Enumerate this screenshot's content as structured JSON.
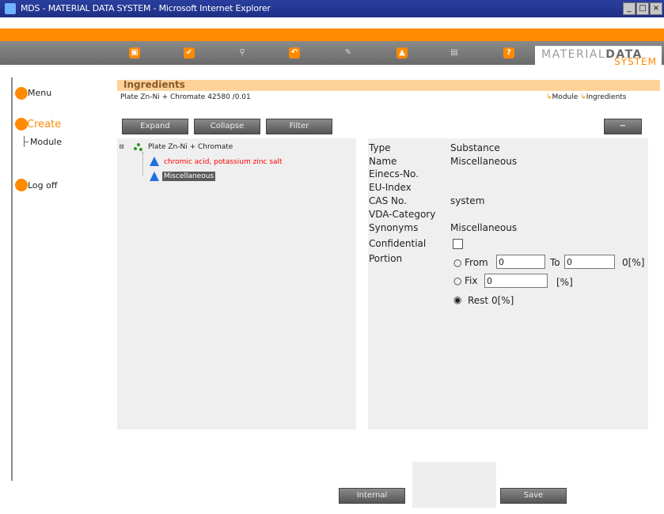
{
  "window": {
    "title": "MDS - MATERIAL DATA SYSTEM - Microsoft Internet Explorer",
    "controls": [
      "_",
      "□",
      "×"
    ]
  },
  "toolbar": {
    "icons": [
      "save-icon",
      "check-icon",
      "search-icon",
      "export-icon",
      "edit-icon",
      "warning-icon",
      "print-icon",
      "help-icon"
    ],
    "glyphs": [
      "▣",
      "✔",
      "⚲",
      "↶",
      "✎",
      "▲",
      "▤",
      "?"
    ]
  },
  "logo": {
    "line1a": "MATERIAL",
    "line1b": "DATA",
    "line2": "SYSTEM"
  },
  "nav": {
    "menu": "Menu",
    "create": "Create",
    "module": "Module",
    "logoff": "Log off"
  },
  "header": {
    "title": "Ingredients",
    "subtitle": "Plate Zn-Ni + Chromate 42580 /0.01",
    "crumb_module": "Module",
    "crumb_ingredients": "Ingredients"
  },
  "buttons": {
    "expand": "Expand",
    "collapse": "Collapse",
    "filter": "Filter",
    "minus": "−",
    "internal": "Internal",
    "save": "Save"
  },
  "tree": {
    "root": "Plate Zn-Ni + Chromate",
    "child1": "chromic acid, potassium zinc salt",
    "child2": "Miscellaneous"
  },
  "details": {
    "labels": {
      "type": "Type",
      "name": "Name",
      "einecs": "Einecs-No.",
      "euindex": "EU-Index",
      "cas": "CAS No.",
      "vda": "VDA-Category",
      "synonyms": "Synonyms",
      "confidential": "Confidential",
      "portion": "Portion"
    },
    "values": {
      "type": "Substance",
      "name": "Miscellaneous",
      "einecs": "",
      "euindex": "",
      "cas": "system",
      "vda": "",
      "synonyms": "Miscellaneous"
    },
    "portion": {
      "from_label": "From",
      "from_value": "0",
      "to_label": "To",
      "to_value": "0",
      "range_suffix": "0[%]",
      "fix_label": "Fix",
      "fix_value": "0",
      "fix_suffix": "[%]",
      "rest_label": "Rest 0[%]",
      "selected": "Rest 0[%]"
    },
    "confidential_checked": false
  },
  "colors": {
    "accent": "#ff8a00",
    "tree_selected": "#5a5a5a",
    "link_red": "#ff0000",
    "tree_icon": "#1f6fe0"
  }
}
